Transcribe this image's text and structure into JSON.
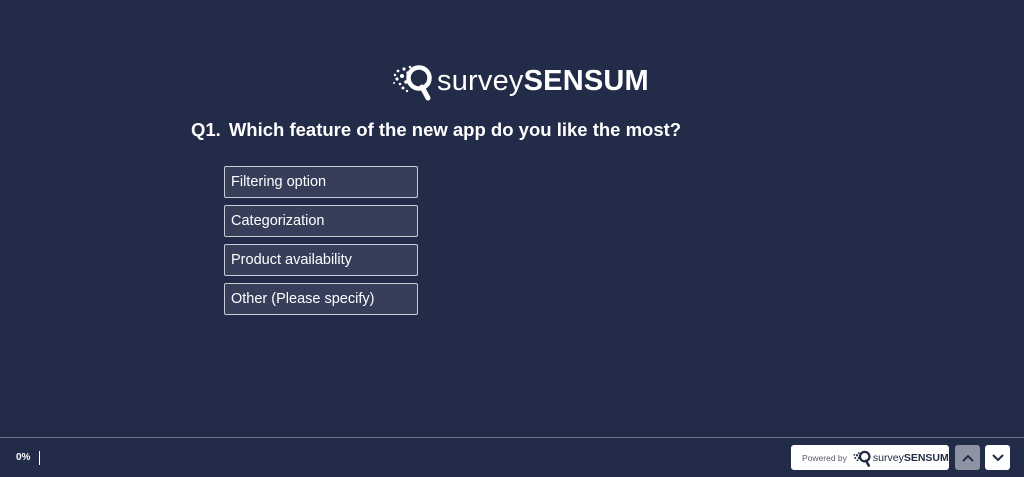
{
  "brand": {
    "name_light": "survey",
    "name_bold": "SENSUM",
    "logo_icon": "surveysensum-logo-icon"
  },
  "question": {
    "number": "Q1.",
    "text": "Which feature of the new app do you like the most?",
    "options": [
      "Filtering option",
      "Categorization",
      "Product availability",
      "Other (Please specify)"
    ]
  },
  "footer": {
    "progress_label": "0%",
    "progress_value": 0,
    "powered_by_label": "Powered by",
    "powered_brand_light": "survey",
    "powered_brand_bold": "SENSUM",
    "prev_icon": "chevron-up-icon",
    "next_icon": "chevron-down-icon"
  },
  "colors": {
    "background": "#222b47",
    "option_fill": "#363e5a",
    "option_border": "#c9ccd6",
    "prev_button": "#8e93a3",
    "next_button": "#ffffff"
  }
}
